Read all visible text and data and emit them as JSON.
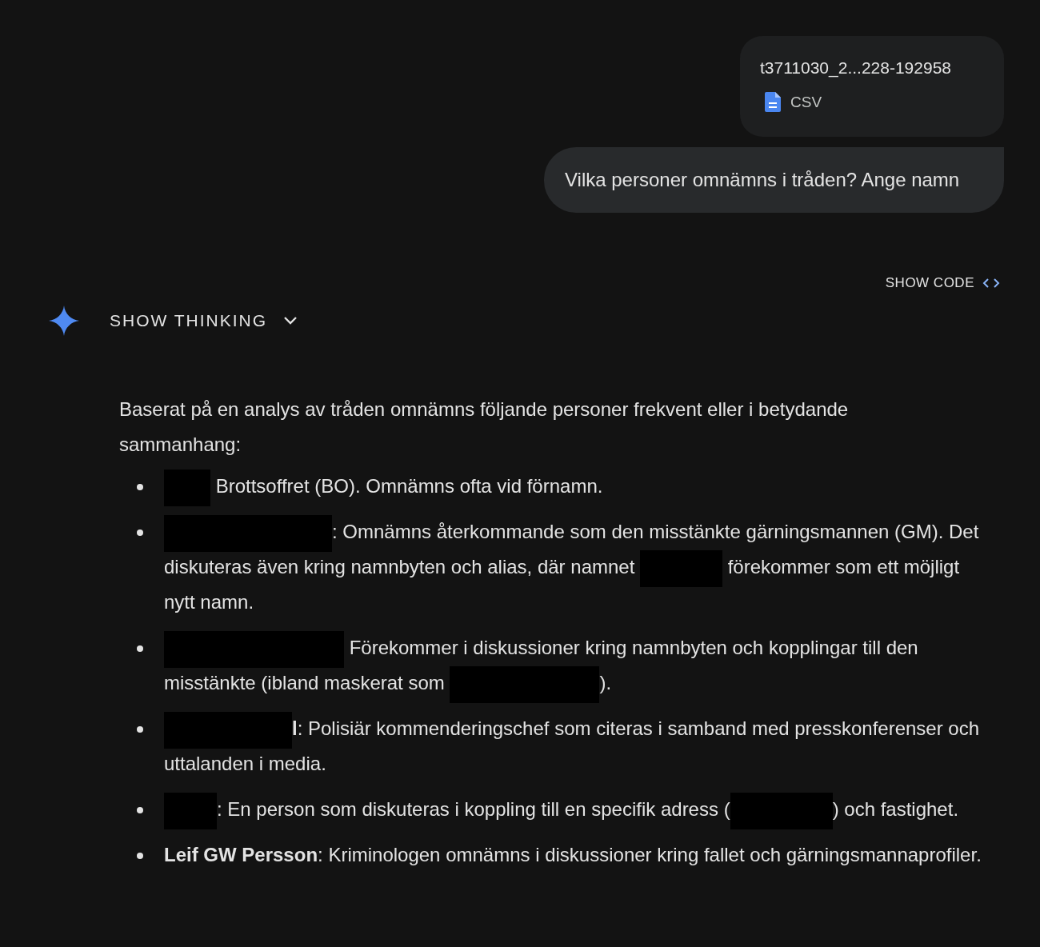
{
  "attachment": {
    "filename": "t3711030_2...228-192958",
    "type": "CSV"
  },
  "user_message": "Vilka personer omnämns i tråden? Ange namn",
  "show_code": "SHOW CODE",
  "show_thinking": {
    "label": "SHOW THINKING",
    "expanded": false
  },
  "response": {
    "intro": "Baserat på en analys av tråden omnämns följande personer frekvent eller i betydande sammanhang:",
    "items": [
      {
        "segments": [
          {
            "kind": "redacted"
          },
          {
            "kind": "text",
            "text": " Brottsoffret (BO). Omnämns ofta vid förnamn."
          }
        ]
      },
      {
        "segments": [
          {
            "kind": "redacted"
          },
          {
            "kind": "text",
            "text": ": Omnämns återkommande som den misstänkte gärningsmannen (GM). Det diskuteras även kring namnbyten och alias, där namnet "
          },
          {
            "kind": "redacted"
          },
          {
            "kind": "text",
            "text": " förekommer som ett möjligt nytt namn."
          }
        ]
      },
      {
        "segments": [
          {
            "kind": "redacted"
          },
          {
            "kind": "text",
            "text": " Förekommer i diskussioner kring namnbyten och kopplingar till den misstänkte (ibland maskerat som "
          },
          {
            "kind": "redacted"
          },
          {
            "kind": "text",
            "text": ")."
          }
        ]
      },
      {
        "segments": [
          {
            "kind": "redacted"
          },
          {
            "kind": "text",
            "text": "**l**: Polisiär kommenderingschef som citeras i samband med presskonferenser och uttalanden i media."
          }
        ]
      },
      {
        "segments": [
          {
            "kind": "redacted"
          },
          {
            "kind": "text",
            "text": ": En person som diskuteras i koppling till en specifik adress ("
          },
          {
            "kind": "redacted"
          },
          {
            "kind": "text",
            "text": ") och fastighet."
          }
        ]
      },
      {
        "segments": [
          {
            "kind": "text",
            "text": "**Leif GW Persson**: Kriminologen omnämns i diskussioner kring fallet och gärningsmannaprofiler."
          }
        ]
      }
    ]
  }
}
